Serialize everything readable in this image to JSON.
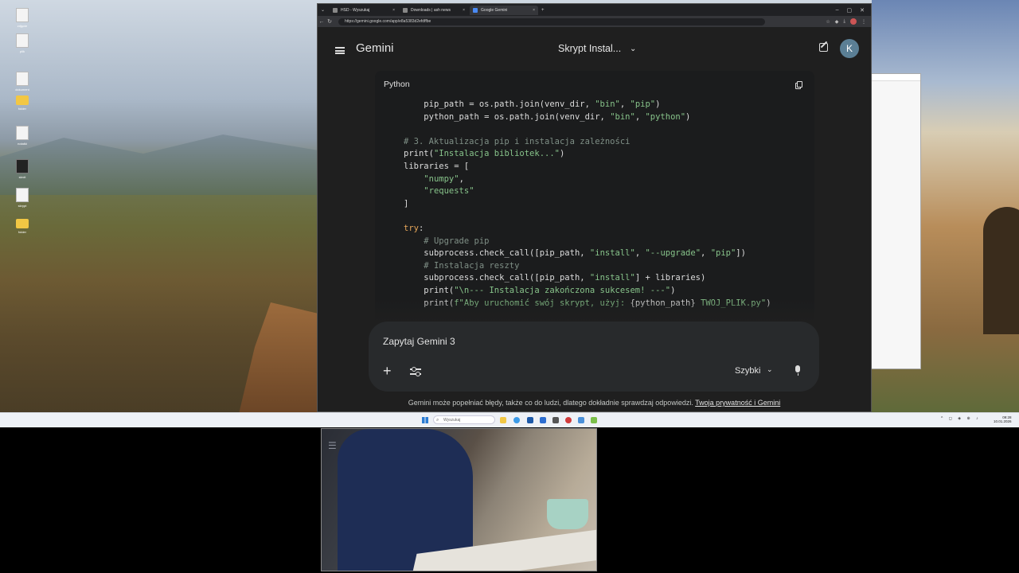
{
  "desktop": {
    "icons": [
      {
        "label": "zdjęcie",
        "kind": "doc"
      },
      {
        "label": "plik",
        "kind": "doc"
      },
      {
        "label": "dokument",
        "kind": "doc"
      },
      {
        "label": "folder",
        "kind": "folder"
      },
      {
        "label": "notatki",
        "kind": "doc"
      },
      {
        "label": "skrót",
        "kind": "dark"
      },
      {
        "label": "skrypt",
        "kind": "doc"
      },
      {
        "label": "folder",
        "kind": "folder"
      }
    ]
  },
  "browser": {
    "tabs": [
      {
        "label": "HSD - Wyszukaj",
        "active": false
      },
      {
        "label": "Downloads | ash news",
        "active": false
      },
      {
        "label": "Google Gemini",
        "active": true
      }
    ],
    "new_tab_label": "+",
    "url": "https://gemini.google.com/app/e8a5383d2efdffbe"
  },
  "gemini": {
    "logo": "Gemini",
    "chat_title": "Skrypt Instal...",
    "avatar_letter": "K",
    "code_language": "Python",
    "code_lines": [
      {
        "indent": "    ",
        "parts": [
          {
            "t": "pip_path = os.path.join(venv_dir, ",
            "c": ""
          },
          {
            "t": "\"bin\"",
            "c": "s"
          },
          {
            "t": ", ",
            "c": ""
          },
          {
            "t": "\"pip\"",
            "c": "s"
          },
          {
            "t": ")",
            "c": ""
          }
        ]
      },
      {
        "indent": "    ",
        "parts": [
          {
            "t": "python_path = os.path.join(venv_dir, ",
            "c": ""
          },
          {
            "t": "\"bin\"",
            "c": "s"
          },
          {
            "t": ", ",
            "c": ""
          },
          {
            "t": "\"python\"",
            "c": "s"
          },
          {
            "t": ")",
            "c": ""
          }
        ]
      },
      {
        "indent": "",
        "parts": []
      },
      {
        "indent": "",
        "parts": [
          {
            "t": "# 3. Aktualizacja pip i instalacja zależności",
            "c": "c"
          }
        ]
      },
      {
        "indent": "",
        "parts": [
          {
            "t": "print(",
            "c": ""
          },
          {
            "t": "\"Instalacja bibliotek...\"",
            "c": "s"
          },
          {
            "t": ")",
            "c": ""
          }
        ]
      },
      {
        "indent": "",
        "parts": [
          {
            "t": "libraries = [",
            "c": ""
          }
        ]
      },
      {
        "indent": "    ",
        "parts": [
          {
            "t": "\"numpy\"",
            "c": "s"
          },
          {
            "t": ",",
            "c": ""
          }
        ]
      },
      {
        "indent": "    ",
        "parts": [
          {
            "t": "\"requests\"",
            "c": "s"
          }
        ]
      },
      {
        "indent": "",
        "parts": [
          {
            "t": "]",
            "c": ""
          }
        ]
      },
      {
        "indent": "",
        "parts": []
      },
      {
        "indent": "",
        "parts": [
          {
            "t": "try",
            "c": "k"
          },
          {
            "t": ":",
            "c": ""
          }
        ]
      },
      {
        "indent": "    ",
        "parts": [
          {
            "t": "# Upgrade pip",
            "c": "c"
          }
        ]
      },
      {
        "indent": "    ",
        "parts": [
          {
            "t": "subprocess.check_call([pip_path, ",
            "c": ""
          },
          {
            "t": "\"install\"",
            "c": "s"
          },
          {
            "t": ", ",
            "c": ""
          },
          {
            "t": "\"--upgrade\"",
            "c": "s"
          },
          {
            "t": ", ",
            "c": ""
          },
          {
            "t": "\"pip\"",
            "c": "s"
          },
          {
            "t": "])",
            "c": ""
          }
        ]
      },
      {
        "indent": "    ",
        "parts": [
          {
            "t": "# Instalacja reszty",
            "c": "c"
          }
        ]
      },
      {
        "indent": "    ",
        "parts": [
          {
            "t": "subprocess.check_call([pip_path, ",
            "c": ""
          },
          {
            "t": "\"install\"",
            "c": "s"
          },
          {
            "t": "] + libraries)",
            "c": ""
          }
        ]
      },
      {
        "indent": "    ",
        "parts": [
          {
            "t": "print(",
            "c": ""
          },
          {
            "t": "\"\\n--- Instalacja zakończona sukcesem! ---\"",
            "c": "s"
          },
          {
            "t": ")",
            "c": ""
          }
        ]
      },
      {
        "indent": "    ",
        "parts": [
          {
            "t": "print(",
            "c": ""
          },
          {
            "t": "f\"Aby uruchomić swój skrypt, użyj: ",
            "c": "s"
          },
          {
            "t": "{python_path}",
            "c": ""
          },
          {
            "t": " TWOJ_PLIK.py\"",
            "c": "s"
          },
          {
            "t": ")",
            "c": ""
          }
        ]
      }
    ],
    "prompt_placeholder": "Zapytaj Gemini 3",
    "mode_label": "Szybki",
    "disclaimer_text": "Gemini może popełniać błędy, także co do ludzi, dlatego dokładnie sprawdzaj odpowiedzi. ",
    "disclaimer_link": "Twoja prywatność i Gemini"
  },
  "taskbar": {
    "search_placeholder": "Wyszukaj",
    "time": "09:28",
    "date": "10.01.2026"
  },
  "icons": [
    "menu-icon",
    "edit-icon",
    "copy-icon",
    "plus-icon",
    "tools-icon",
    "chevron-down-icon",
    "mic-icon",
    "windows-start-icon",
    "search-icon"
  ]
}
